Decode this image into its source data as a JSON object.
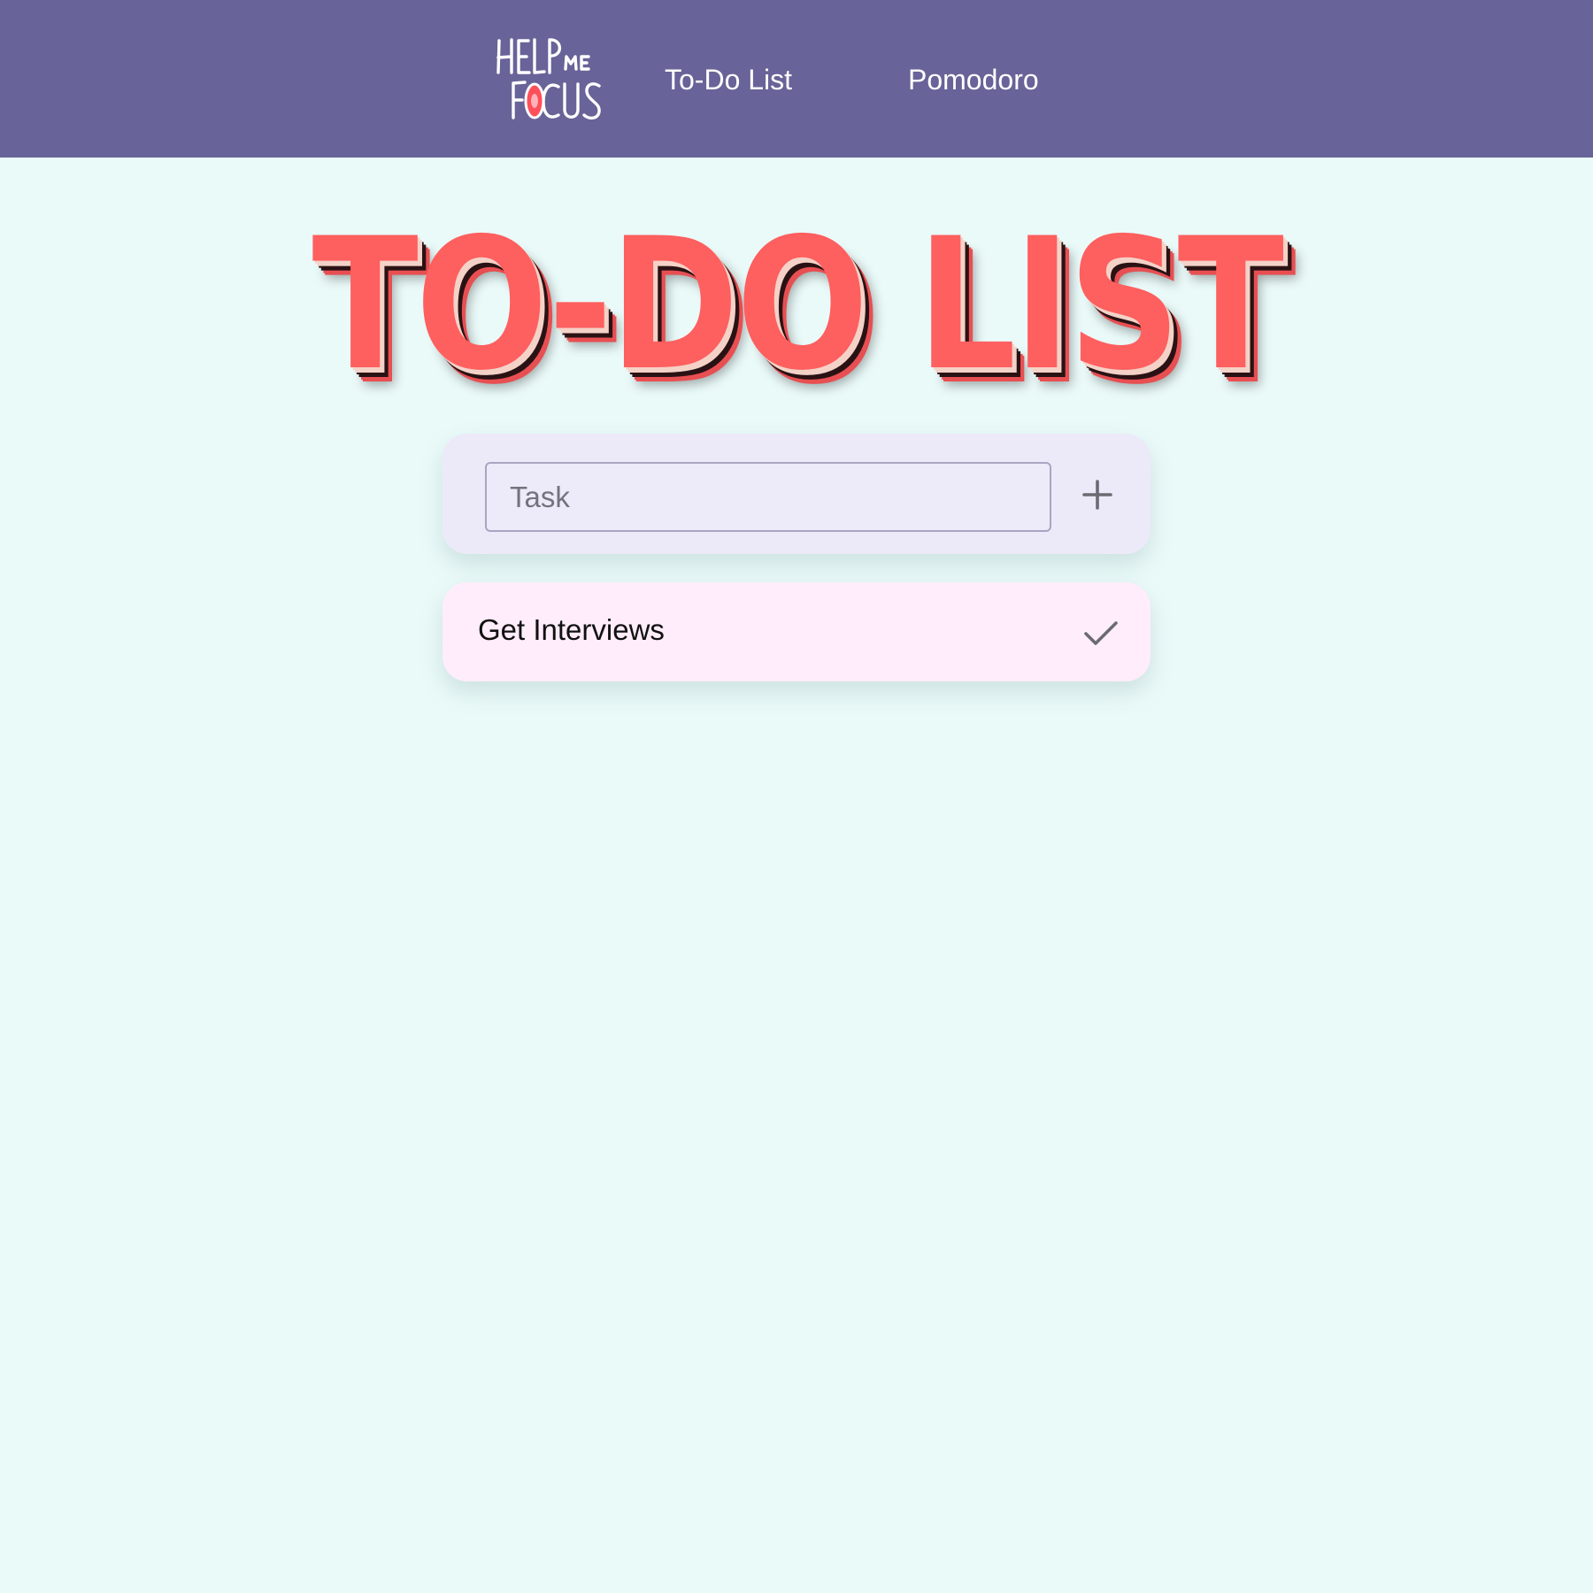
{
  "colors": {
    "navbar_bg": "#686398",
    "page_bg": "#eafaf9",
    "title_red": "#fe5f5f",
    "add_card_bg": "#eceaf9",
    "task_card_bg": "#ffedfb",
    "icon_gray": "#6b6b72"
  },
  "navbar": {
    "logo": {
      "text_line1": "HELP",
      "text_me": "ME",
      "text_line2": "FOCUS",
      "icon": "help-me-focus-logo"
    },
    "links": [
      {
        "label": "To-Do List"
      },
      {
        "label": "Pomodoro"
      }
    ]
  },
  "main": {
    "title": "TO-DO LIST",
    "new_task": {
      "placeholder": "Task",
      "value": "",
      "add_icon": "plus-icon"
    },
    "tasks": [
      {
        "label": "Get Interviews",
        "action_icon": "check-icon"
      }
    ]
  }
}
